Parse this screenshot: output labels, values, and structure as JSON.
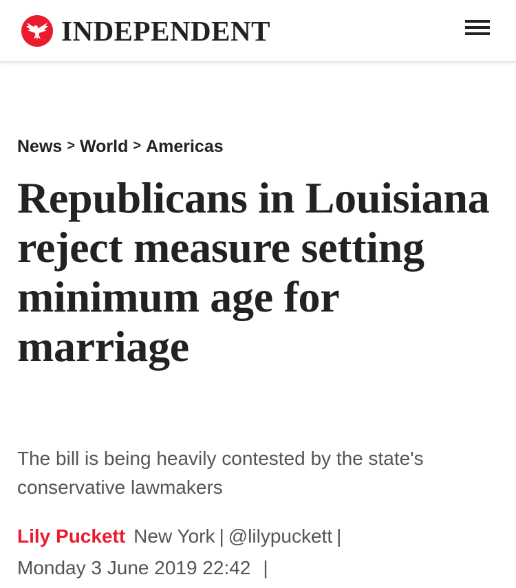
{
  "header": {
    "logo_text": "INDEPENDENT",
    "logo_icon": "eagle-icon",
    "menu_icon": "hamburger-menu-icon"
  },
  "breadcrumb": {
    "items": [
      "News",
      "World",
      "Americas"
    ],
    "separator": ">"
  },
  "article": {
    "headline": "Republicans in Louisiana reject measure setting minimum age for marriage",
    "standfirst": "The bill is being heavily contested by the state's conservative lawmakers",
    "author": "Lily Puckett",
    "location": "New York",
    "twitter_handle": "@lilypuckett",
    "timestamp": "Monday 3 June 2019 22:42",
    "divider": "|"
  },
  "colors": {
    "brand_red": "#ec1a2e",
    "text": "#222222",
    "muted_text": "#555555"
  }
}
